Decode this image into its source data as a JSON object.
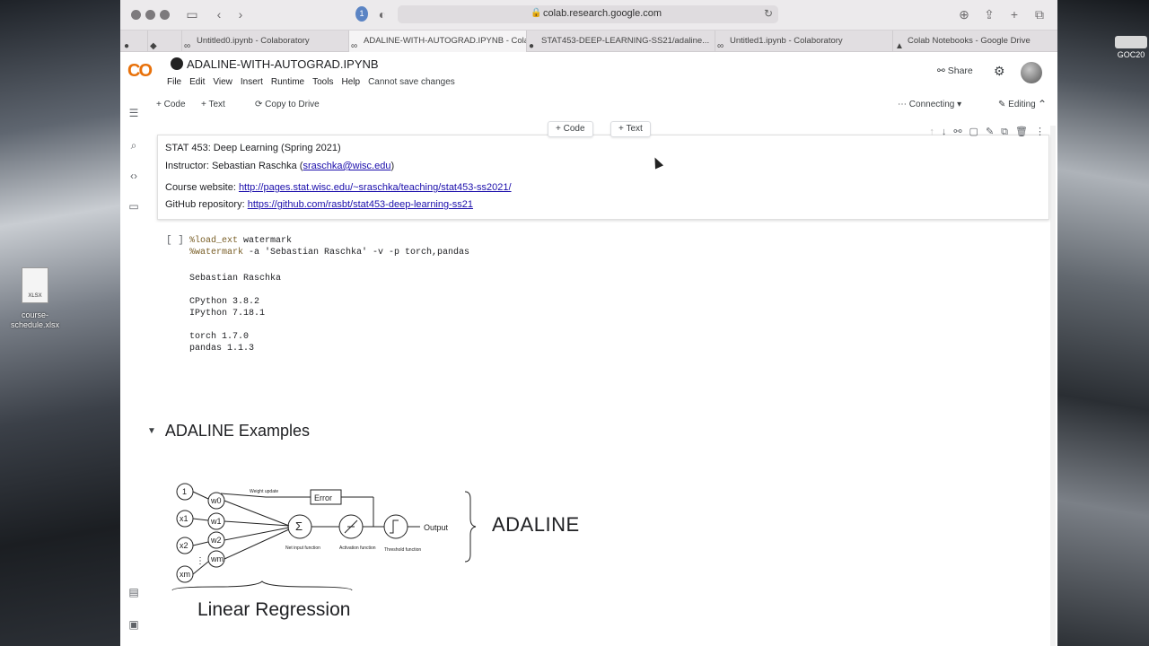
{
  "browser": {
    "url": "colab.research.google.com",
    "tabs": [
      {
        "label": "Untitled0.ipynb - Colaboratory",
        "icon": "colab-icon"
      },
      {
        "label": "ADALINE-WITH-AUTOGRAD.IPYNB - Colab...",
        "icon": "colab-icon",
        "active": true
      },
      {
        "label": "STAT453-DEEP-LEARNING-SS21/adaline...",
        "icon": "github-icon"
      },
      {
        "label": "Untitled1.ipynb - Colaboratory",
        "icon": "colab-icon"
      },
      {
        "label": "Colab Notebooks - Google Drive",
        "icon": "drive-icon"
      }
    ]
  },
  "desktop": {
    "file_name": "course-schedule.xlsx",
    "file_ext": "XLSX",
    "drive_label": "GOC20"
  },
  "colab": {
    "logo": "CO",
    "title": "ADALINE-WITH-AUTOGRAD.IPYNB",
    "menu": [
      "File",
      "Edit",
      "View",
      "Insert",
      "Runtime",
      "Tools",
      "Help"
    ],
    "menu_note": "Cannot save changes",
    "share_label": "Share",
    "toolbar": {
      "code": "+ Code",
      "text": "+ Text",
      "copy_drive": "Copy to Drive",
      "connecting": "Connecting",
      "editing": "Editing"
    },
    "float": {
      "code": "+ Code",
      "text": "+ Text"
    }
  },
  "text_cell": {
    "line1": "STAT 453: Deep Learning (Spring 2021)",
    "instructor_prefix": "Instructor: Sebastian Raschka (",
    "instructor_email": "sraschka@wisc.edu",
    "instructor_suffix": ")",
    "website_prefix": "Course website: ",
    "website_url": "http://pages.stat.wisc.edu/~sraschka/teaching/stat453-ss2021/",
    "github_prefix": "GitHub repository: ",
    "github_url": "https://github.com/rasbt/stat453-deep-learning-ss21"
  },
  "code_cell": {
    "run_bracket": "[ ]",
    "line1_kw": "%load_ext",
    "line1_rest": " watermark",
    "line2_kw": "%watermark",
    "line2_rest": " -a 'Sebastian Raschka' -v -p torch,pandas",
    "output": "Sebastian Raschka\n\nCPython 3.8.2\nIPython 7.18.1\n\ntorch 1.7.0\npandas 1.1.3"
  },
  "section": {
    "title": "ADALINE Examples"
  },
  "diagram": {
    "adaline_label": "ADALINE",
    "linreg_label": "Linear Regression",
    "inputs": [
      "1",
      "x1",
      "x2",
      "xm"
    ],
    "weights": [
      "w0",
      "w1",
      "w2",
      "wm"
    ],
    "weight_update": "Weight update",
    "error": "Error",
    "net_input": "Net input function",
    "activation": "Activation function",
    "threshold": "Threshold function",
    "output": "Output"
  }
}
